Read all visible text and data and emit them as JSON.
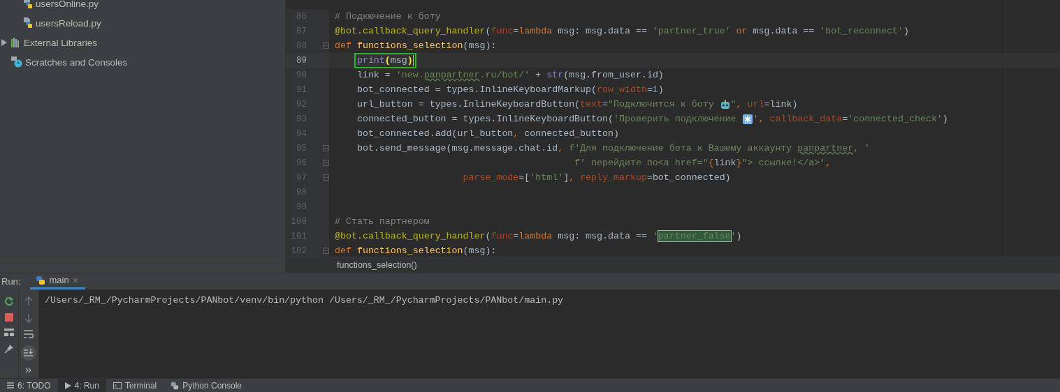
{
  "project_tree": [
    {
      "label": "usersOnline.py",
      "kind": "python_file"
    },
    {
      "label": "usersReload.py",
      "kind": "python_file"
    },
    {
      "label": "External Libraries",
      "kind": "libraries",
      "expandable": true
    },
    {
      "label": "Scratches and Consoles",
      "kind": "scratches"
    }
  ],
  "editor": {
    "lines": [
      {
        "number": "86",
        "tokens": [
          {
            "kind": "comment",
            "text": "# Подкючение к боту"
          }
        ]
      },
      {
        "number": "87",
        "tokens": [
          {
            "kind": "decorator",
            "text": "@bot.callback_query_handler"
          },
          {
            "kind": "plain",
            "text": "("
          },
          {
            "kind": "param",
            "text": "func"
          },
          {
            "kind": "plain",
            "text": "="
          },
          {
            "kind": "keyword",
            "text": "lambda"
          },
          {
            "kind": "plain",
            "text": " msg: msg.data == "
          },
          {
            "kind": "string",
            "text": "'partner_true' "
          },
          {
            "kind": "keyword",
            "text": "or"
          },
          {
            "kind": "plain",
            "text": " msg.data == "
          },
          {
            "kind": "string",
            "text": "'bot_reconnect'"
          },
          {
            "kind": "plain",
            "text": ")"
          }
        ]
      },
      {
        "number": "88",
        "fold": true,
        "tokens": [
          {
            "kind": "keyword",
            "text": "def "
          },
          {
            "kind": "function",
            "text": "functions_selection"
          },
          {
            "kind": "plain",
            "text": "(msg):"
          }
        ]
      },
      {
        "number": "89",
        "current": true,
        "boxed": true,
        "tokens": [
          {
            "kind": "builtin",
            "text": "    print"
          },
          {
            "kind": "bracket",
            "text": "("
          },
          {
            "kind": "plain",
            "text": "msg"
          },
          {
            "kind": "bracket",
            "text": ")"
          }
        ]
      },
      {
        "number": "90",
        "tokens": [
          {
            "kind": "plain",
            "text": "    link = "
          },
          {
            "kind": "string",
            "text": "'new."
          },
          {
            "kind": "typo",
            "text": "panpartner"
          },
          {
            "kind": "string",
            "text": ".ru/bot/'"
          },
          {
            "kind": "plain",
            "text": " + "
          },
          {
            "kind": "builtin",
            "text": "str"
          },
          {
            "kind": "plain",
            "text": "(msg.from_user.id)"
          }
        ]
      },
      {
        "number": "91",
        "tokens": [
          {
            "kind": "plain",
            "text": "    bot_connected = types.InlineKeyboardMarkup("
          },
          {
            "kind": "param",
            "text": "row_width"
          },
          {
            "kind": "plain",
            "text": "="
          },
          {
            "kind": "number",
            "text": "1"
          },
          {
            "kind": "plain",
            "text": ")"
          }
        ]
      },
      {
        "number": "92",
        "tokens": [
          {
            "kind": "plain",
            "text": "    url_button = types.InlineKeyboardButton("
          },
          {
            "kind": "param",
            "text": "text"
          },
          {
            "kind": "plain",
            "text": "="
          },
          {
            "kind": "string",
            "text": "\"Подключится к боту "
          },
          {
            "kind": "robot_emoji"
          },
          {
            "kind": "string",
            "text": "\""
          },
          {
            "kind": "keyword",
            "text": ", "
          },
          {
            "kind": "param",
            "text": "url"
          },
          {
            "kind": "plain",
            "text": "=link)"
          }
        ]
      },
      {
        "number": "93",
        "tokens": [
          {
            "kind": "plain",
            "text": "    connected_button = types.InlineKeyboardButton("
          },
          {
            "kind": "string",
            "text": "'Проверить подключение "
          },
          {
            "kind": "asterisk_emoji"
          },
          {
            "kind": "string",
            "text": "'"
          },
          {
            "kind": "keyword",
            "text": ", "
          },
          {
            "kind": "param",
            "text": "callback_data"
          },
          {
            "kind": "plain",
            "text": "="
          },
          {
            "kind": "string",
            "text": "'connected_check'"
          },
          {
            "kind": "plain",
            "text": ")"
          }
        ]
      },
      {
        "number": "94",
        "tokens": [
          {
            "kind": "plain",
            "text": "    bot_connected.add(url_button"
          },
          {
            "kind": "keyword",
            "text": ", "
          },
          {
            "kind": "plain",
            "text": "connected_button)"
          }
        ]
      },
      {
        "number": "95",
        "fold": true,
        "tokens": [
          {
            "kind": "plain",
            "text": "    bot.send_message(msg.message.chat.id"
          },
          {
            "kind": "keyword",
            "text": ", "
          },
          {
            "kind": "string",
            "text": "f'Для подключение бота к Вашему аккаунту "
          },
          {
            "kind": "typo",
            "text": "panpartner"
          },
          {
            "kind": "string",
            "text": ", '"
          }
        ]
      },
      {
        "number": "96",
        "fold": true,
        "tokens": [
          {
            "kind": "string",
            "text": "                                           f' перейдите по<a href=\""
          },
          {
            "kind": "keyword",
            "text": "{"
          },
          {
            "kind": "plain",
            "text": "link"
          },
          {
            "kind": "keyword",
            "text": "}"
          },
          {
            "kind": "string",
            "text": "\"> ссылке!</a>'"
          },
          {
            "kind": "keyword",
            "text": ","
          }
        ]
      },
      {
        "number": "97",
        "fold": true,
        "tokens": [
          {
            "kind": "param",
            "text": "                       parse_mode"
          },
          {
            "kind": "plain",
            "text": "=["
          },
          {
            "kind": "string",
            "text": "'html'"
          },
          {
            "kind": "plain",
            "text": "]"
          },
          {
            "kind": "keyword",
            "text": ", "
          },
          {
            "kind": "param",
            "text": "reply_markup"
          },
          {
            "kind": "plain",
            "text": "=bot_connected)"
          }
        ]
      },
      {
        "number": "98"
      },
      {
        "number": "99"
      },
      {
        "number": "100",
        "tokens": [
          {
            "kind": "comment",
            "text": "# Стать партнером"
          }
        ]
      },
      {
        "number": "101",
        "tokens": [
          {
            "kind": "decorator",
            "text": "@bot.callback_query_handler"
          },
          {
            "kind": "plain",
            "text": "("
          },
          {
            "kind": "param",
            "text": "func"
          },
          {
            "kind": "plain",
            "text": "="
          },
          {
            "kind": "keyword",
            "text": "lambda"
          },
          {
            "kind": "plain",
            "text": " msg: msg.data == "
          },
          {
            "kind": "string",
            "text": "'"
          },
          {
            "kind": "match",
            "text": "partner_false"
          },
          {
            "kind": "string",
            "text": "'"
          },
          {
            "kind": "plain",
            "text": ")"
          }
        ]
      },
      {
        "number": "102",
        "fold": true,
        "tokens": [
          {
            "kind": "keyword",
            "text": "def "
          },
          {
            "kind": "function",
            "text": "functions_selection"
          },
          {
            "kind": "plain",
            "text": "(msg):"
          }
        ]
      }
    ],
    "breadcrumb": "functions_selection()"
  },
  "run_panel": {
    "label": "Run:",
    "tabs": [
      {
        "label": "main",
        "selected": true
      }
    ],
    "console_lines": [
      "/Users/_RM_/PycharmProjects/PANbot/venv/bin/python /Users/_RM_/PycharmProjects/PANbot/main.py"
    ]
  },
  "bottom_tabs": [
    {
      "label": "6: TODO",
      "kind": "todo",
      "selected": false
    },
    {
      "label": "4: Run",
      "kind": "run",
      "selected": true
    },
    {
      "label": "Terminal",
      "kind": "terminal",
      "selected": false
    },
    {
      "label": "Python Console",
      "kind": "python",
      "selected": false
    }
  ]
}
